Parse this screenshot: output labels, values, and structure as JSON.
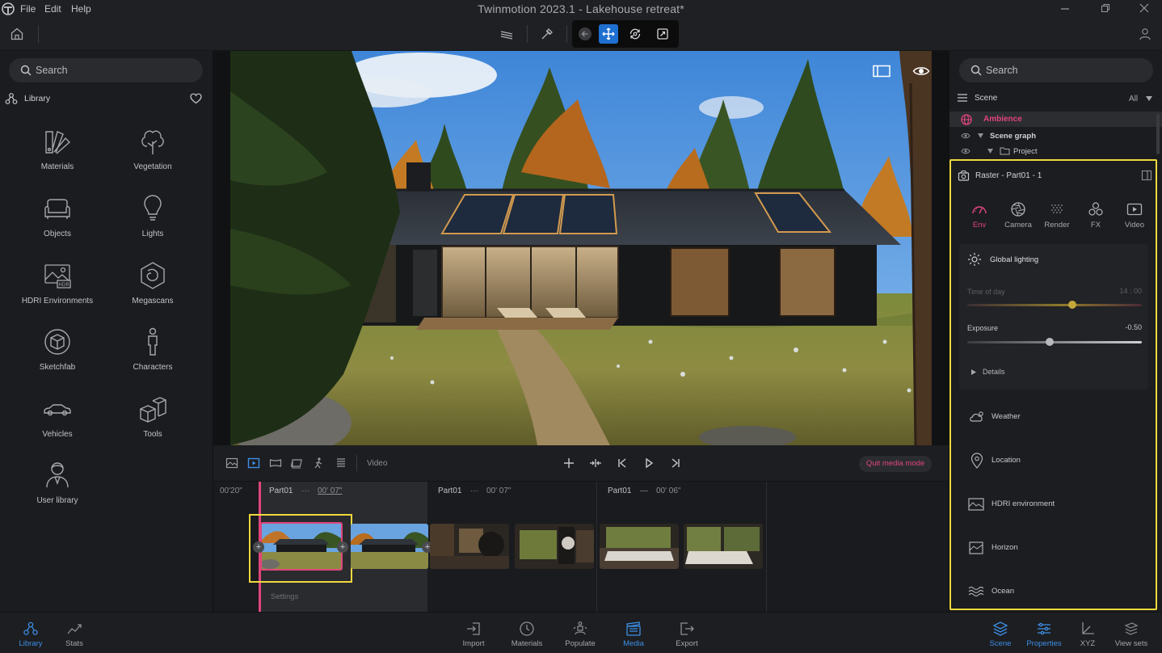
{
  "app": {
    "title": "Twinmotion 2023.1  -  Lakehouse retreat*",
    "menu": [
      "File",
      "Edit",
      "Help"
    ]
  },
  "left_panel": {
    "search_placeholder": "Search",
    "library_label": "Library",
    "items": [
      {
        "label": "Materials",
        "icon": "materials-icon"
      },
      {
        "label": "Vegetation",
        "icon": "tree-icon"
      },
      {
        "label": "Objects",
        "icon": "sofa-icon"
      },
      {
        "label": "Lights",
        "icon": "bulb-icon"
      },
      {
        "label": "HDRI Environments",
        "icon": "hdri-icon"
      },
      {
        "label": "Megascans",
        "icon": "megascans-icon"
      },
      {
        "label": "Sketchfab",
        "icon": "cube-icon"
      },
      {
        "label": "Characters",
        "icon": "person-icon"
      },
      {
        "label": "Vehicles",
        "icon": "car-icon"
      },
      {
        "label": "Tools",
        "icon": "tools-icon"
      },
      {
        "label": "User library",
        "icon": "user-library-icon"
      }
    ]
  },
  "media_bar": {
    "video_label": "Video",
    "quit_label": "Quit media mode"
  },
  "timeline": {
    "time_label": "00'20\"",
    "segments": [
      {
        "name": "Part01",
        "sep": "···",
        "duration": "00' 07\""
      },
      {
        "name": "Part01",
        "sep": "···",
        "duration": "00' 07\""
      },
      {
        "name": "Part01",
        "sep": "—",
        "duration": "00' 06\""
      }
    ],
    "settings_label": "Settings"
  },
  "right_panel": {
    "search_placeholder": "Search",
    "scene_label": "Scene",
    "filter_label": "All",
    "tree": {
      "ambience": "Ambience",
      "scene_graph": "Scene graph",
      "project": "Project"
    },
    "props_title": "Raster - Part01 - 1",
    "tabs": [
      {
        "label": "Env",
        "icon": "env-gauge-icon"
      },
      {
        "label": "Camera",
        "icon": "aperture-icon"
      },
      {
        "label": "Render",
        "icon": "render-dots-icon"
      },
      {
        "label": "FX",
        "icon": "fx-circles-icon"
      },
      {
        "label": "Video",
        "icon": "video-play-icon"
      }
    ],
    "global_lighting": "Global lighting",
    "time_of_day_label": "Time of day",
    "time_of_day_value": "14 : 00",
    "time_of_day_fraction": 0.6,
    "exposure_label": "Exposure",
    "exposure_value": "-0.50",
    "exposure_fraction": 0.47,
    "details_label": "Details",
    "sections": [
      {
        "label": "Weather",
        "icon": "weather-icon"
      },
      {
        "label": "Location",
        "icon": "location-pin-icon"
      },
      {
        "label": "HDRI environment",
        "icon": "hdri-env-icon"
      },
      {
        "label": "Horizon",
        "icon": "horizon-icon"
      },
      {
        "label": "Ocean",
        "icon": "ocean-icon"
      }
    ]
  },
  "bottom_bar": {
    "left": [
      {
        "label": "Library",
        "active": true
      },
      {
        "label": "Stats",
        "active": false
      }
    ],
    "center": [
      {
        "label": "Import",
        "active": false
      },
      {
        "label": "Materials",
        "active": false
      },
      {
        "label": "Populate",
        "active": false
      },
      {
        "label": "Media",
        "active": true
      },
      {
        "label": "Export",
        "active": false
      }
    ],
    "right": [
      {
        "label": "Scene",
        "active": true
      },
      {
        "label": "Properties",
        "active": true
      },
      {
        "label": "XYZ",
        "active": false
      },
      {
        "label": "View sets",
        "active": false
      }
    ]
  },
  "colors": {
    "accent_blue": "#1f6fd1",
    "accent_pink": "#e0457b",
    "highlight_yellow": "#f0d93e"
  }
}
